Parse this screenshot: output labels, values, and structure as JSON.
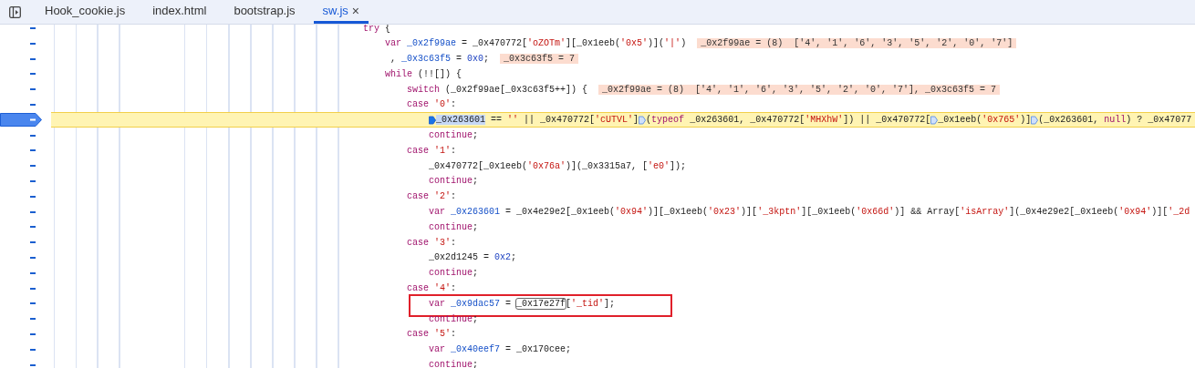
{
  "tabs": [
    {
      "label": "Hook_cookie.js",
      "selected": false,
      "closable": false
    },
    {
      "label": "index.html",
      "selected": false,
      "closable": false
    },
    {
      "label": "bootstrap.js",
      "selected": false,
      "closable": false
    },
    {
      "label": "sw.js",
      "selected": true,
      "closable": true,
      "close": "×"
    }
  ],
  "lines": [
    {
      "kind": "statement",
      "paused": false,
      "boxed": false,
      "tokens": [
        {
          "kind": "keyword",
          "text": "try"
        },
        {
          "kind": "plain",
          "text": " {"
        }
      ],
      "children": [
        {
          "kind": "statement",
          "paused": false,
          "boxed": false,
          "tokens": [
            {
              "kind": "keyword",
              "text": "var "
            },
            {
              "kind": "definition",
              "text": "_0x2f99ae"
            },
            {
              "kind": "plain",
              "text": " = _0x470772["
            },
            {
              "kind": "string",
              "text": "'oZOTm'"
            },
            {
              "kind": "plain",
              "text": "][_0x1eeb("
            },
            {
              "kind": "string",
              "text": "'0x5'"
            },
            {
              "kind": "plain",
              "text": ")]("
            },
            {
              "kind": "string",
              "text": "'|'"
            },
            {
              "kind": "plain",
              "text": ")"
            }
          ],
          "inline_values": [
            "_0x2f99ae = (8)  ['4', '1', '6', '3', '5', '2', '0', '7']"
          ]
        },
        {
          "kind": "continuation",
          "paused": false,
          "boxed": false,
          "tokens": [
            {
              "kind": "plain",
              "text": ", "
            },
            {
              "kind": "definition",
              "text": "_0x3c63f5"
            },
            {
              "kind": "plain",
              "text": " = "
            },
            {
              "kind": "number",
              "text": "0x0"
            },
            {
              "kind": "plain",
              "text": ";"
            }
          ],
          "inline_values": [
            "_0x3c63f5 = 7"
          ]
        },
        {
          "kind": "statement",
          "paused": false,
          "boxed": false,
          "tokens": [
            {
              "kind": "keyword",
              "text": "while"
            },
            {
              "kind": "plain",
              "text": " (!![]) {"
            }
          ],
          "children": [
            {
              "kind": "statement",
              "paused": false,
              "boxed": false,
              "tokens": [
                {
                  "kind": "keyword",
                  "text": "switch"
                },
                {
                  "kind": "plain",
                  "text": " (_0x2f99ae[_0x3c63f5++]) {"
                }
              ],
              "inline_values": [
                "_0x2f99ae = (8)  ['4', '1', '6', '3', '5', '2', '0', '7'], _0x3c63f5 = 7"
              ],
              "children": [
                {
                  "kind": "case",
                  "paused": false,
                  "boxed": false,
                  "tokens": [
                    {
                      "kind": "keyword",
                      "text": "case "
                    },
                    {
                      "kind": "string",
                      "text": "'0'"
                    },
                    {
                      "kind": "plain",
                      "text": ":"
                    }
                  ],
                  "children": [
                    {
                      "kind": "statement",
                      "paused": true,
                      "boxed": false,
                      "tokens": [
                        {
                          "kind": "marker",
                          "active": true
                        },
                        {
                          "kind": "selection",
                          "text": "_0x263601"
                        },
                        {
                          "kind": "plain",
                          "text": " == "
                        },
                        {
                          "kind": "string",
                          "text": "''"
                        },
                        {
                          "kind": "plain",
                          "text": " || _0x470772["
                        },
                        {
                          "kind": "string",
                          "text": "'cUTVL'"
                        },
                        {
                          "kind": "plain",
                          "text": "]"
                        },
                        {
                          "kind": "marker",
                          "active": false
                        },
                        {
                          "kind": "plain",
                          "text": "("
                        },
                        {
                          "kind": "keyword",
                          "text": "typeof"
                        },
                        {
                          "kind": "plain",
                          "text": " _0x263601, _0x470772["
                        },
                        {
                          "kind": "string",
                          "text": "'MHXhW'"
                        },
                        {
                          "kind": "plain",
                          "text": "]) || _0x470772["
                        },
                        {
                          "kind": "marker",
                          "active": false
                        },
                        {
                          "kind": "plain",
                          "text": "_0x1eeb("
                        },
                        {
                          "kind": "string",
                          "text": "'0x765'"
                        },
                        {
                          "kind": "plain",
                          "text": ")]"
                        },
                        {
                          "kind": "marker",
                          "active": false
                        },
                        {
                          "kind": "plain",
                          "text": "(_0x263601, "
                        },
                        {
                          "kind": "keyword",
                          "text": "null"
                        },
                        {
                          "kind": "plain",
                          "text": ") ? _0x47077"
                        }
                      ]
                    },
                    {
                      "kind": "statement",
                      "paused": false,
                      "boxed": false,
                      "tokens": [
                        {
                          "kind": "keyword",
                          "text": "continue"
                        },
                        {
                          "kind": "plain",
                          "text": ";"
                        }
                      ]
                    }
                  ]
                },
                {
                  "kind": "case",
                  "paused": false,
                  "boxed": false,
                  "tokens": [
                    {
                      "kind": "keyword",
                      "text": "case "
                    },
                    {
                      "kind": "string",
                      "text": "'1'"
                    },
                    {
                      "kind": "plain",
                      "text": ":"
                    }
                  ],
                  "children": [
                    {
                      "kind": "statement",
                      "paused": false,
                      "boxed": false,
                      "tokens": [
                        {
                          "kind": "plain",
                          "text": "_0x470772[_0x1eeb("
                        },
                        {
                          "kind": "string",
                          "text": "'0x76a'"
                        },
                        {
                          "kind": "plain",
                          "text": ")](_0x3315a7, ["
                        },
                        {
                          "kind": "string",
                          "text": "'e0'"
                        },
                        {
                          "kind": "plain",
                          "text": "]);"
                        }
                      ]
                    },
                    {
                      "kind": "statement",
                      "paused": false,
                      "boxed": false,
                      "tokens": [
                        {
                          "kind": "keyword",
                          "text": "continue"
                        },
                        {
                          "kind": "plain",
                          "text": ";"
                        }
                      ]
                    }
                  ]
                },
                {
                  "kind": "case",
                  "paused": false,
                  "boxed": false,
                  "tokens": [
                    {
                      "kind": "keyword",
                      "text": "case "
                    },
                    {
                      "kind": "string",
                      "text": "'2'"
                    },
                    {
                      "kind": "plain",
                      "text": ":"
                    }
                  ],
                  "children": [
                    {
                      "kind": "statement",
                      "paused": false,
                      "boxed": false,
                      "tokens": [
                        {
                          "kind": "keyword",
                          "text": "var "
                        },
                        {
                          "kind": "definition",
                          "text": "_0x263601"
                        },
                        {
                          "kind": "plain",
                          "text": " = _0x4e29e2[_0x1eeb("
                        },
                        {
                          "kind": "string",
                          "text": "'0x94'"
                        },
                        {
                          "kind": "plain",
                          "text": ")][_0x1eeb("
                        },
                        {
                          "kind": "string",
                          "text": "'0x23'"
                        },
                        {
                          "kind": "plain",
                          "text": ")]["
                        },
                        {
                          "kind": "string",
                          "text": "'_3kptn'"
                        },
                        {
                          "kind": "plain",
                          "text": "][_0x1eeb("
                        },
                        {
                          "kind": "string",
                          "text": "'0x66d'"
                        },
                        {
                          "kind": "plain",
                          "text": ")] && Array["
                        },
                        {
                          "kind": "string",
                          "text": "'isArray'"
                        },
                        {
                          "kind": "plain",
                          "text": "](_0x4e29e2[_0x1eeb("
                        },
                        {
                          "kind": "string",
                          "text": "'0x94'"
                        },
                        {
                          "kind": "plain",
                          "text": ")]["
                        },
                        {
                          "kind": "string",
                          "text": "'_2d"
                        }
                      ]
                    },
                    {
                      "kind": "statement",
                      "paused": false,
                      "boxed": false,
                      "tokens": [
                        {
                          "kind": "keyword",
                          "text": "continue"
                        },
                        {
                          "kind": "plain",
                          "text": ";"
                        }
                      ]
                    }
                  ]
                },
                {
                  "kind": "case",
                  "paused": false,
                  "boxed": false,
                  "tokens": [
                    {
                      "kind": "keyword",
                      "text": "case "
                    },
                    {
                      "kind": "string",
                      "text": "'3'"
                    },
                    {
                      "kind": "plain",
                      "text": ":"
                    }
                  ],
                  "children": [
                    {
                      "kind": "statement",
                      "paused": false,
                      "boxed": false,
                      "tokens": [
                        {
                          "kind": "plain",
                          "text": "_0x2d1245 = "
                        },
                        {
                          "kind": "number",
                          "text": "0x2"
                        },
                        {
                          "kind": "plain",
                          "text": ";"
                        }
                      ]
                    },
                    {
                      "kind": "statement",
                      "paused": false,
                      "boxed": false,
                      "tokens": [
                        {
                          "kind": "keyword",
                          "text": "continue"
                        },
                        {
                          "kind": "plain",
                          "text": ";"
                        }
                      ]
                    }
                  ]
                },
                {
                  "kind": "case",
                  "paused": false,
                  "boxed": false,
                  "tokens": [
                    {
                      "kind": "keyword",
                      "text": "case "
                    },
                    {
                      "kind": "string",
                      "text": "'4'"
                    },
                    {
                      "kind": "plain",
                      "text": ":"
                    }
                  ],
                  "children": [
                    {
                      "kind": "statement",
                      "paused": false,
                      "boxed": true,
                      "tokens": [
                        {
                          "kind": "keyword",
                          "text": "var "
                        },
                        {
                          "kind": "definition",
                          "text": "_0x9dac57"
                        },
                        {
                          "kind": "plain",
                          "text": " = "
                        },
                        {
                          "kind": "hovered",
                          "text": "_0x17e27f"
                        },
                        {
                          "kind": "plain",
                          "text": "["
                        },
                        {
                          "kind": "string",
                          "text": "'_tid'"
                        },
                        {
                          "kind": "plain",
                          "text": "];"
                        }
                      ]
                    },
                    {
                      "kind": "statement",
                      "paused": false,
                      "boxed": false,
                      "tokens": [
                        {
                          "kind": "keyword",
                          "text": "continue"
                        },
                        {
                          "kind": "plain",
                          "text": ";"
                        }
                      ]
                    }
                  ]
                },
                {
                  "kind": "case",
                  "paused": false,
                  "boxed": false,
                  "tokens": [
                    {
                      "kind": "keyword",
                      "text": "case "
                    },
                    {
                      "kind": "string",
                      "text": "'5'"
                    },
                    {
                      "kind": "plain",
                      "text": ":"
                    }
                  ],
                  "children": [
                    {
                      "kind": "statement",
                      "paused": false,
                      "boxed": false,
                      "tokens": [
                        {
                          "kind": "keyword",
                          "text": "var "
                        },
                        {
                          "kind": "definition",
                          "text": "_0x40eef7"
                        },
                        {
                          "kind": "plain",
                          "text": " = _0x170cee;"
                        }
                      ]
                    },
                    {
                      "kind": "statement",
                      "paused": false,
                      "boxed": false,
                      "tokens": [
                        {
                          "kind": "keyword",
                          "text": "continue"
                        },
                        {
                          "kind": "plain",
                          "text": ";"
                        }
                      ]
                    }
                  ]
                }
              ]
            }
          ]
        }
      ]
    }
  ]
}
